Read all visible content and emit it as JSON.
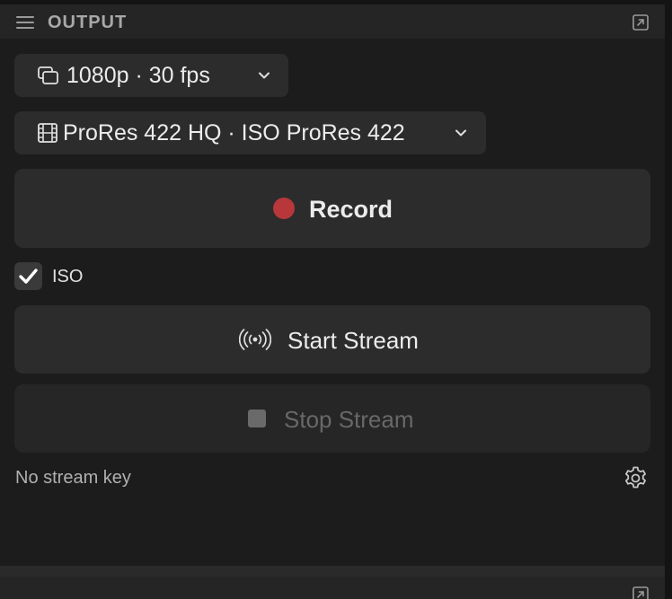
{
  "header": {
    "title": "OUTPUT",
    "menu_icon": "hamburger-icon",
    "popout_icon": "popout-icon"
  },
  "resolution_dropdown": {
    "icon": "display-stack-icon",
    "value": "1080p · 30 fps"
  },
  "codec_dropdown": {
    "icon": "film-icon",
    "value": "ProRes 422 HQ · ISO ProRes 422"
  },
  "record_button": {
    "label": "Record",
    "dot_color": "#b8373b"
  },
  "iso_checkbox": {
    "label": "ISO",
    "checked": true
  },
  "start_stream_button": {
    "icon": "broadcast-icon",
    "label": "Start Stream"
  },
  "stop_stream_button": {
    "icon": "stop-icon",
    "label": "Stop Stream",
    "disabled": true
  },
  "footer": {
    "status": "No stream key",
    "settings_icon": "gear-icon"
  },
  "colors": {
    "background": "#1c1c1c",
    "panel": "#2c2c2c",
    "record_red": "#b8373b"
  }
}
